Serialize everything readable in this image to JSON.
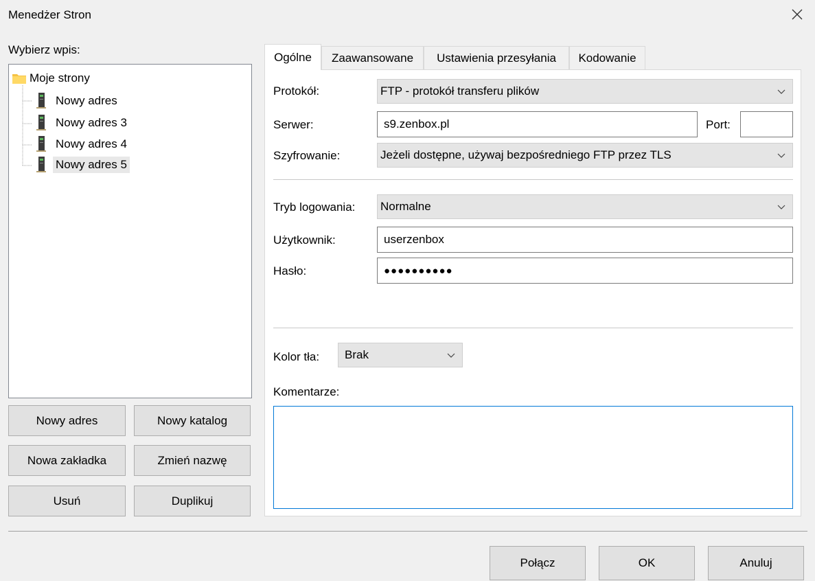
{
  "window": {
    "title": "Menedżer Stron"
  },
  "left": {
    "label": "Wybierz wpis:",
    "tree": {
      "root": "Moje strony",
      "children": [
        "Nowy adres",
        "Nowy adres 3",
        "Nowy adres 4",
        "Nowy adres 5"
      ],
      "selected_index": 3
    },
    "buttons": {
      "new_site": "Nowy adres",
      "new_folder": "Nowy katalog",
      "new_bookmark": "Nowa zakładka",
      "rename": "Zmień nazwę",
      "delete": "Usuń",
      "duplicate": "Duplikuj"
    }
  },
  "tabs": [
    "Ogólne",
    "Zaawansowane",
    "Ustawienia przesyłania",
    "Kodowanie"
  ],
  "general": {
    "protocol_label": "Protokół:",
    "protocol_value": "FTP - protokół transferu plików",
    "server_label": "Serwer:",
    "server_value": "s9.zenbox.pl",
    "port_label": "Port:",
    "port_value": "",
    "encryption_label": "Szyfrowanie:",
    "encryption_value": "Jeżeli dostępne, używaj bezpośredniego FTP przez TLS",
    "logon_label": "Tryb logowania:",
    "logon_value": "Normalne",
    "user_label": "Użytkownik:",
    "user_value": "userzenbox",
    "password_label": "Hasło:",
    "password_value": "●●●●●●●●●●",
    "bgcolor_label": "Kolor tła:",
    "bgcolor_value": "Brak",
    "comments_label": "Komentarze:",
    "comments_value": ""
  },
  "footer": {
    "connect": "Połącz",
    "ok": "OK",
    "cancel": "Anuluj"
  },
  "colors": {
    "accent": "#0078d7",
    "folder": "#f5c244"
  }
}
